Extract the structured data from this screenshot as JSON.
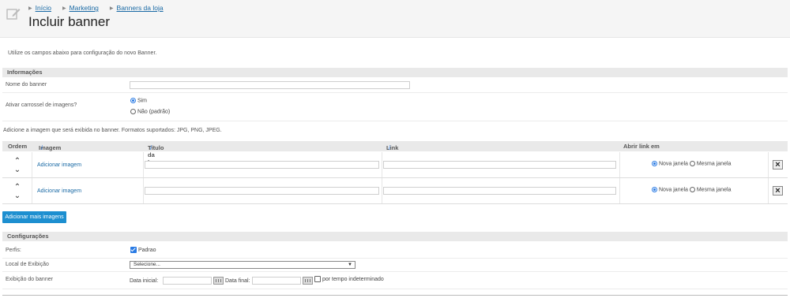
{
  "breadcrumb": [
    "Início",
    "Marketing",
    "Banners da loja"
  ],
  "page_title": "Incluir banner",
  "intro": "Utilize os campos abaixo para configuração do novo Banner.",
  "informacoes": {
    "title": "Informações",
    "nome_label": "Nome do banner",
    "nome_value": "",
    "carrossel_label": "Ativar carrossel de imagens?",
    "opt_sim": "Sim",
    "opt_nao": "Não (padrão)"
  },
  "image_note": "Adicione a imagem que será exibida no banner. Formatos suportados: JPG, PNG, JPEG.",
  "table": {
    "col_ordem": "Ordem",
    "col_imagem": "Imagem",
    "col_titulo": "Título da Imagem",
    "col_link": "Link",
    "col_abrir": "Abrir link em",
    "rows": [
      {
        "add_label": "Adicionar imagem",
        "titulo": "",
        "link": "",
        "opt_nova": "Nova janela",
        "opt_mesma": "Mesma janela"
      },
      {
        "add_label": "Adicionar imagem",
        "titulo": "",
        "link": "",
        "opt_nova": "Nova janela",
        "opt_mesma": "Mesma janela"
      }
    ]
  },
  "add_more_label": "Adicionar mais imagens",
  "configuracoes": {
    "title": "Configurações",
    "perfis_label": "Perfis:",
    "perfil_padrao": "Padrao",
    "local_label": "Local de Exibição",
    "local_value": "Selecione...",
    "exibicao_label": "Exibição do banner",
    "data_inicial": "Data inicial:",
    "data_final": "Data final:",
    "indeterminado": "por tempo indeterminado"
  },
  "colors": {
    "accent": "#1d8fd0",
    "link": "#1a6aa5"
  }
}
